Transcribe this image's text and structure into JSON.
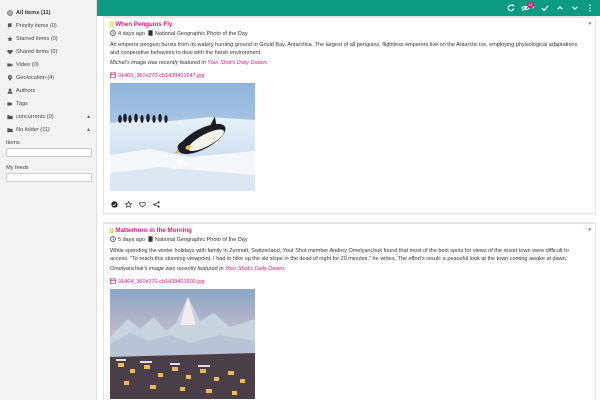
{
  "sidebar": {
    "items": [
      {
        "label": "All items (11)",
        "icon": "globe-icon"
      },
      {
        "label": "Priority items (0)",
        "icon": "flag-icon"
      },
      {
        "label": "Starred items (0)",
        "icon": "star-icon"
      },
      {
        "label": "Shared items (0)",
        "icon": "heart-icon"
      },
      {
        "label": "Video (0)",
        "icon": "video-icon"
      },
      {
        "label": "Geolocation (4)",
        "icon": "location-pin-icon"
      },
      {
        "label": "Authors",
        "icon": "user-icon"
      },
      {
        "label": "Tags",
        "icon": "tag-icon"
      },
      {
        "label": "concurrents (0)",
        "icon": "folder-icon"
      },
      {
        "label": "No folder (11)",
        "icon": "folder-icon"
      }
    ],
    "items_section": "Items",
    "feeds_section": "My feeds"
  },
  "topbar": {
    "badge_count": "11",
    "icons": [
      "refresh-icon",
      "unread-eye-icon",
      "caret-down-icon",
      "mark-read-icon",
      "previous-icon",
      "next-icon",
      "more-vertical-icon"
    ],
    "accent": "#0a9b82",
    "badge_color": "#e4177f"
  },
  "articles": [
    {
      "title": "When Penguins Fly",
      "age": "4 days ago",
      "source": "National Geographic Photo of the Day",
      "paragraph": "An emperor penguin bursts from its watery hunting ground in Gould Bay, Antarctica. The largest of all penguins, flightless emperors live on the Antarctic ice, employing physiological adaptations and cooperative behaviors to deal with the harsh environment.",
      "credit_prefix": "Michel's image was recently featured in ",
      "credit_link": "Your Shot's Daily Dozen",
      "credit_suffix": ".",
      "attachment": "91465_360x270-cb1439401647.jpg"
    },
    {
      "title": "Matterhorn in the Morning",
      "age": "5 days ago",
      "source": "National Geographic Photo of the Day",
      "paragraph": "While spending the winter holidays with family in Zermatt, Switzerland, Your Shot member Andrey Omelyanchuk found that most of the best spots for views of the resort town were difficult to access. \"To reach this stunning viewpoint, I had to hike up the ski slope in the dead of night for 20 minutes,\" he writes. The effort's result: a peaceful look at the town coming awake at dawn.",
      "credit_prefix": "Omelyanchuk's image was recently featured in ",
      "credit_link": "Your Shot's Daily Dozen",
      "credit_suffix": ".",
      "attachment": "91464_360x270-cb1439401600.jpg"
    }
  ],
  "colors": {
    "link": "#e4177f",
    "star": "#f0b400"
  }
}
